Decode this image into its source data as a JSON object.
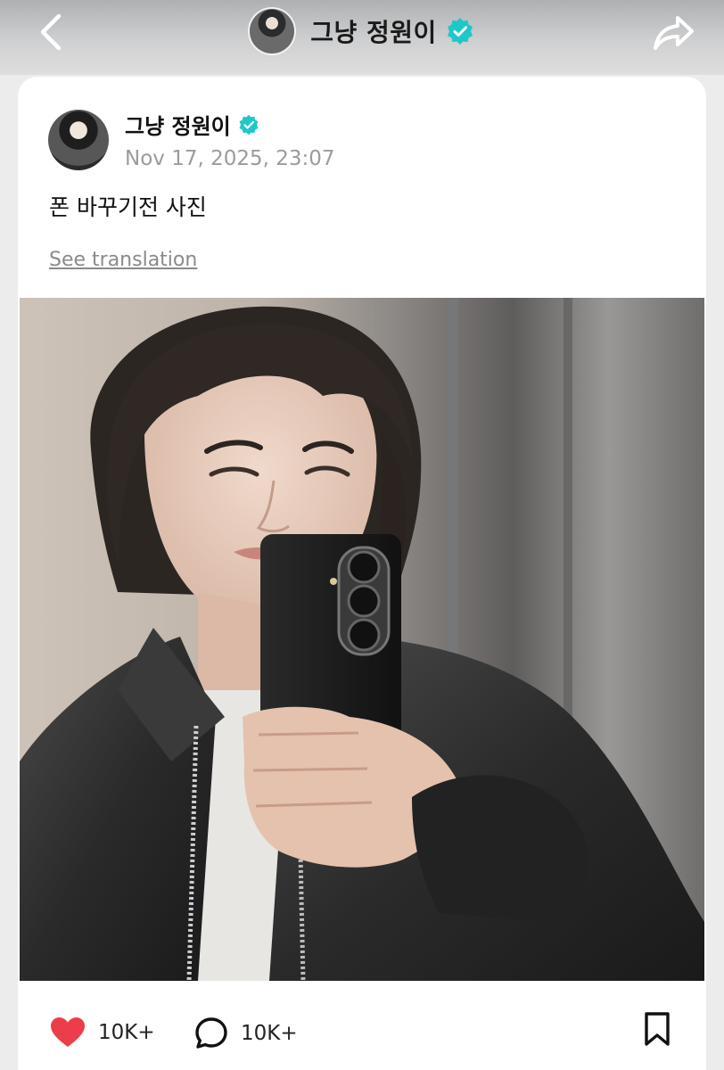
{
  "header": {
    "title": "그냥 정원이",
    "back_icon": "chevron-left-icon",
    "share_icon": "share-arrow-icon",
    "verified_icon": "verified-badge-icon"
  },
  "post": {
    "author_name": "그냥 정원이",
    "timestamp": "Nov 17, 2025, 23:07",
    "text": "폰 바꾸기전 사진",
    "see_translation": "See translation",
    "photo_icon": "photo-image"
  },
  "actions": {
    "likes": "10K+",
    "comments": "10K+",
    "like_icon": "heart-icon",
    "comment_icon": "comment-bubble-icon",
    "bookmark_icon": "bookmark-icon"
  },
  "colors": {
    "verified": "#1ec8c8",
    "heart": "#ec3e4a",
    "timestamp": "#9b9b9b",
    "link": "#8a8a8a"
  }
}
